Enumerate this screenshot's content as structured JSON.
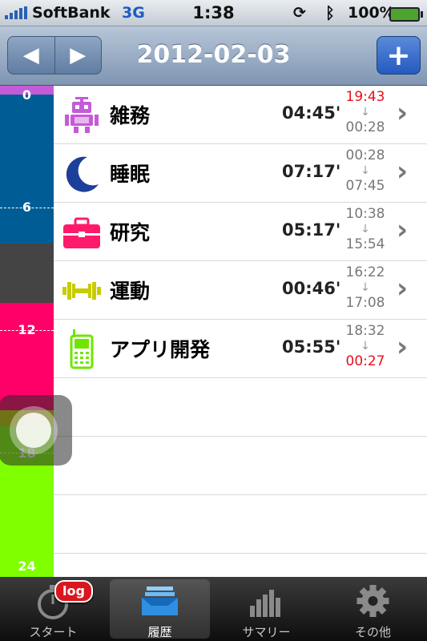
{
  "status_bar": {
    "carrier": "SoftBank",
    "network": "3G",
    "time": "1:38",
    "battery": "100%"
  },
  "nav": {
    "title": "2012-02-03",
    "prev_label": "◀",
    "next_label": "▶",
    "add_label": "+"
  },
  "timeline": {
    "labels": [
      "0",
      "6",
      "12",
      "18",
      "24"
    ],
    "colors": {
      "chores": "#c45bd6",
      "sleep": "#005c94",
      "research": "#ff0068",
      "exercise": "#c7cc00",
      "app_dev": "#80ff00",
      "gap": "#444444"
    }
  },
  "entries": [
    {
      "name": "雑務",
      "duration": "04:45'",
      "start": "19:43",
      "arrow": "↓",
      "end": "00:28",
      "icon": "robot-icon",
      "color": "#c45bd6"
    },
    {
      "name": "睡眠",
      "duration": "07:17'",
      "start": "00:28",
      "arrow": "↓",
      "end": "07:45",
      "icon": "crescent-moon-icon",
      "color": "#1d3f99"
    },
    {
      "name": "研究",
      "duration": "05:17'",
      "start": "10:38",
      "arrow": "↓",
      "end": "15:54",
      "icon": "briefcase-icon",
      "color": "#ff1a6c"
    },
    {
      "name": "運動",
      "duration": "00:46'",
      "start": "16:22",
      "arrow": "↓",
      "end": "17:08",
      "icon": "dumbbell-icon",
      "color": "#c7cc00"
    },
    {
      "name": "アプリ開発",
      "duration": "05:55'",
      "start": "18:32",
      "arrow": "↓",
      "end": "00:27",
      "icon": "mobile-phone-icon",
      "color": "#6ee600"
    }
  ],
  "tabs": [
    {
      "label": "スタート",
      "icon": "stopwatch-icon",
      "badge": "log"
    },
    {
      "label": "履歴",
      "icon": "inbox-tray-icon"
    },
    {
      "label": "サマリー",
      "icon": "bar-chart-icon"
    },
    {
      "label": "その他",
      "icon": "gear-icon"
    }
  ],
  "active_tab": 1
}
